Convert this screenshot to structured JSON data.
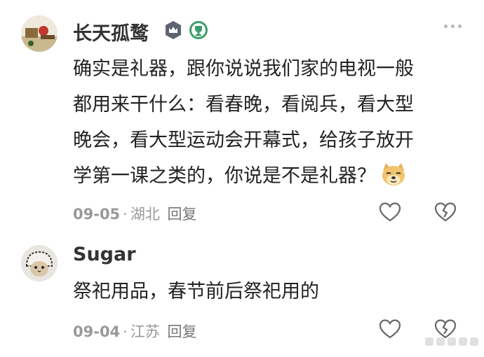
{
  "comments": [
    {
      "username": "长天孤鹜",
      "lines": [
        "确实是礼器，跟你说说我们家的电视一般",
        "都用来干什么：看春晚，看阅兵，看大型",
        "晚会，看大型运动会开幕式，给孩子放开",
        "学第一课之类的，你说是不是礼器？"
      ],
      "emoji": "doge-emoji",
      "date": "09-05",
      "location": "湖北",
      "reply_label": "回复",
      "badges": [
        "rank-badge-icon",
        "trophy-badge-icon"
      ]
    },
    {
      "username": "Sugar",
      "lines": [
        "祭祀用品，春节前后祭祀用的"
      ],
      "date": "09-04",
      "location": "江苏",
      "reply_label": "回复"
    }
  ],
  "separator": "·",
  "colors": {
    "text": "#222222",
    "meta": "#999999",
    "username": "#333333",
    "badge_green": "#3a9d6a",
    "badge_gray": "#5d6470"
  }
}
